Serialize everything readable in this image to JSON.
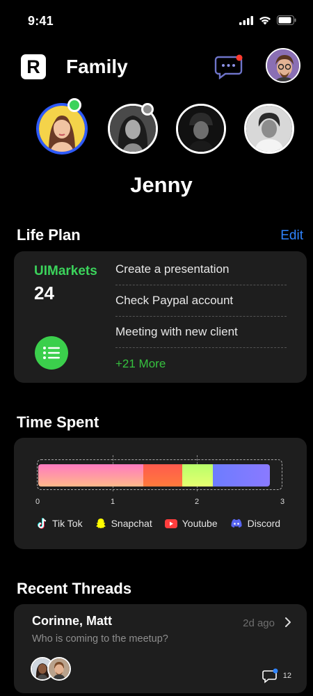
{
  "status": {
    "time": "9:41"
  },
  "header": {
    "logo_letter": "R",
    "title": "Family"
  },
  "members": {
    "items": [
      {
        "name": "member-1",
        "presence": "online"
      },
      {
        "name": "member-2",
        "presence": "away"
      },
      {
        "name": "member-3",
        "presence": "none"
      },
      {
        "name": "member-4",
        "presence": "none"
      }
    ],
    "selected_name": "Jenny"
  },
  "life_plan": {
    "title": "Life Plan",
    "edit_label": "Edit",
    "brand": "UIMarkets",
    "count": "24",
    "tasks": [
      "Create a presentation",
      "Check Paypal account",
      "Meeting with new client"
    ],
    "more_label": "+21 More"
  },
  "time_spent": {
    "title": "Time Spent",
    "ticks": [
      "0",
      "1",
      "2",
      "3"
    ],
    "legend": [
      {
        "label": "Tik Tok",
        "icon": "tiktok-icon"
      },
      {
        "label": "Snapchat",
        "icon": "snapchat-icon"
      },
      {
        "label": "Youtube",
        "icon": "youtube-icon"
      },
      {
        "label": "Discord",
        "icon": "discord-icon"
      }
    ],
    "segments": [
      {
        "app": "Tik Tok",
        "value": 1.25
      },
      {
        "app": "Snapchat",
        "value": 0.46
      },
      {
        "app": "Youtube",
        "value": 0.36
      },
      {
        "app": "Discord",
        "value": 0.68
      }
    ]
  },
  "threads": {
    "title": "Recent Threads",
    "items": [
      {
        "name": "Corinne, Matt",
        "preview": "Who is coming to the meetup?",
        "time": "2d ago",
        "comments": "12"
      }
    ]
  },
  "colors": {
    "accent_blue": "#2f84ff",
    "green": "#3bd35b",
    "card_bg": "#1e1e1e",
    "notification": "#ff3b30"
  }
}
